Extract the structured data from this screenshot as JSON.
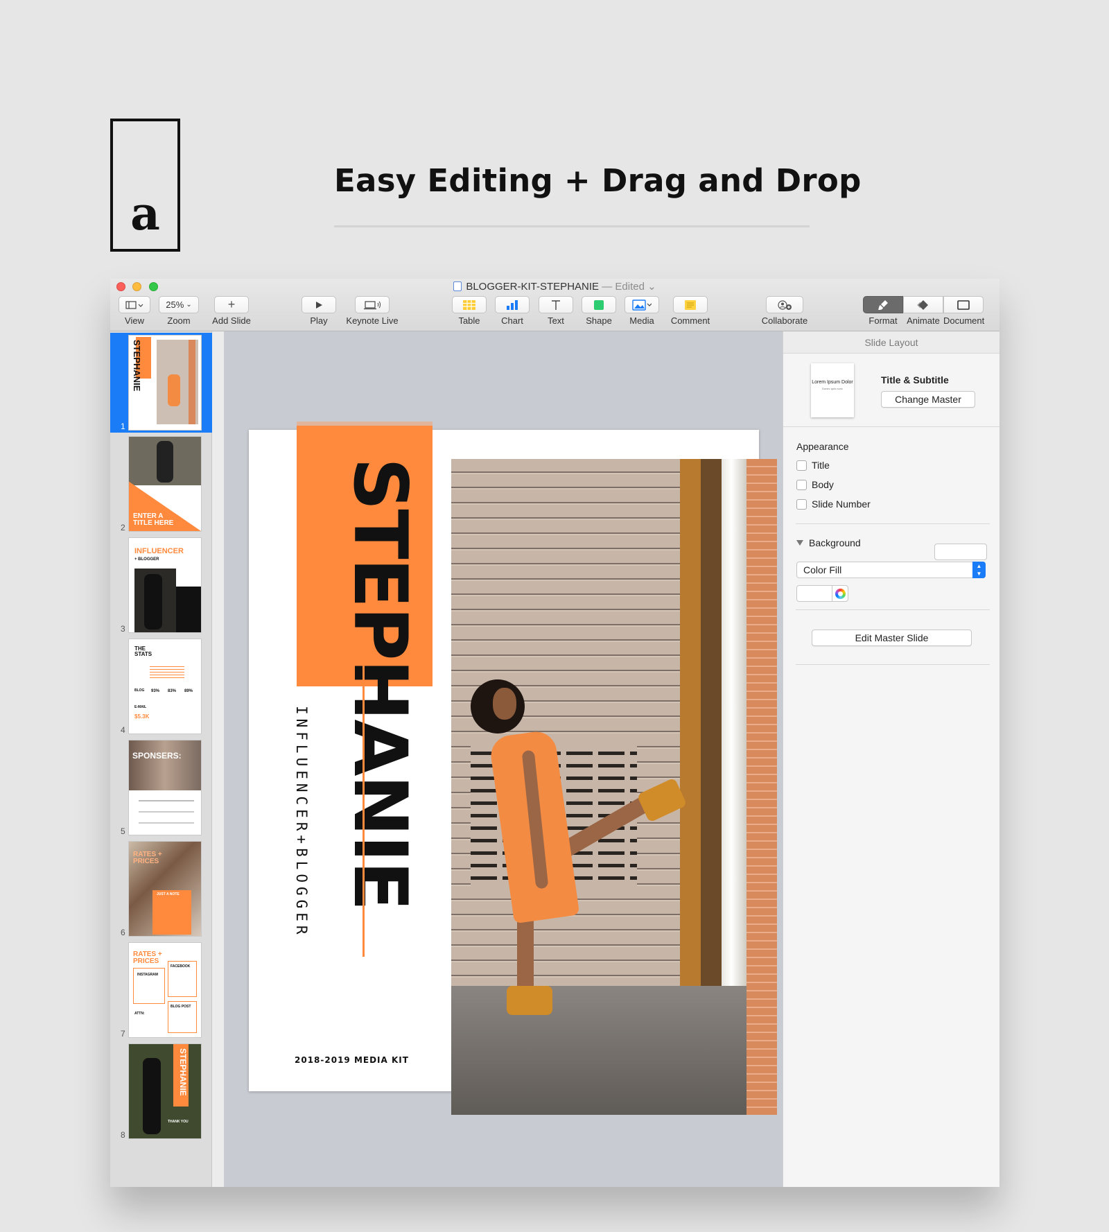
{
  "promo": {
    "logo_letter": "a",
    "headline": "Easy Editing + Drag and Drop"
  },
  "window": {
    "doc_title": "BLOGGER-KIT-STEPHANIE",
    "doc_status": "— Edited"
  },
  "toolbar": {
    "view_label": "View",
    "zoom_value": "25%",
    "zoom_label": "Zoom",
    "add_slide_label": "Add Slide",
    "play_label": "Play",
    "keynote_live_label": "Keynote Live",
    "table_label": "Table",
    "chart_label": "Chart",
    "text_label": "Text",
    "shape_label": "Shape",
    "media_label": "Media",
    "comment_label": "Comment",
    "collaborate_label": "Collaborate",
    "format_label": "Format",
    "animate_label": "Animate",
    "document_label": "Document"
  },
  "navigator": {
    "selected": 1,
    "slides": [
      {
        "number": "1",
        "text": "STEPHANIE"
      },
      {
        "number": "2",
        "text": "ENTER A TITLE HERE"
      },
      {
        "number": "3",
        "text": "INFLUENCER",
        "sub": "+ BLOGGER"
      },
      {
        "number": "4",
        "text": "THE STATS",
        "stats": [
          "93%",
          "83%",
          "89%"
        ],
        "email_value": "$5.3K",
        "blog_label": "BLOG",
        "email_label": "E-MAIL"
      },
      {
        "number": "5",
        "text": "SPONSERS:"
      },
      {
        "number": "6",
        "text": "RATES + PRICES",
        "sub": "JUST A NOTE"
      },
      {
        "number": "7",
        "text": "RATES + PRICES",
        "labels": [
          "INSTAGRAM",
          "FACEBOOK",
          "BLOG POST",
          "ATTN:"
        ]
      },
      {
        "number": "8",
        "text": "STEPHANIE",
        "sub": "THANK YOU"
      }
    ]
  },
  "slide": {
    "title": "STEPHANIE",
    "subtitle": "INFLUENCER+BLOGGER",
    "footer": "2018-2019 MEDIA KIT",
    "accent": "#ff8a3d"
  },
  "inspector": {
    "header": "Slide Layout",
    "layout_thumb_title": "Lorem Ipsum Dolor",
    "layout_thumb_sub": "Donec quis nunc",
    "layout_name": "Title & Subtitle",
    "change_master": "Change Master",
    "appearance_title": "Appearance",
    "appearance_options": [
      {
        "label": "Title",
        "checked": false
      },
      {
        "label": "Body",
        "checked": false
      },
      {
        "label": "Slide Number",
        "checked": false
      }
    ],
    "background_title": "Background",
    "fill_type": "Color Fill",
    "edit_master": "Edit Master Slide"
  },
  "colors": {
    "selection_blue": "#1a7cf7",
    "accent_orange": "#ff8a3d"
  }
}
